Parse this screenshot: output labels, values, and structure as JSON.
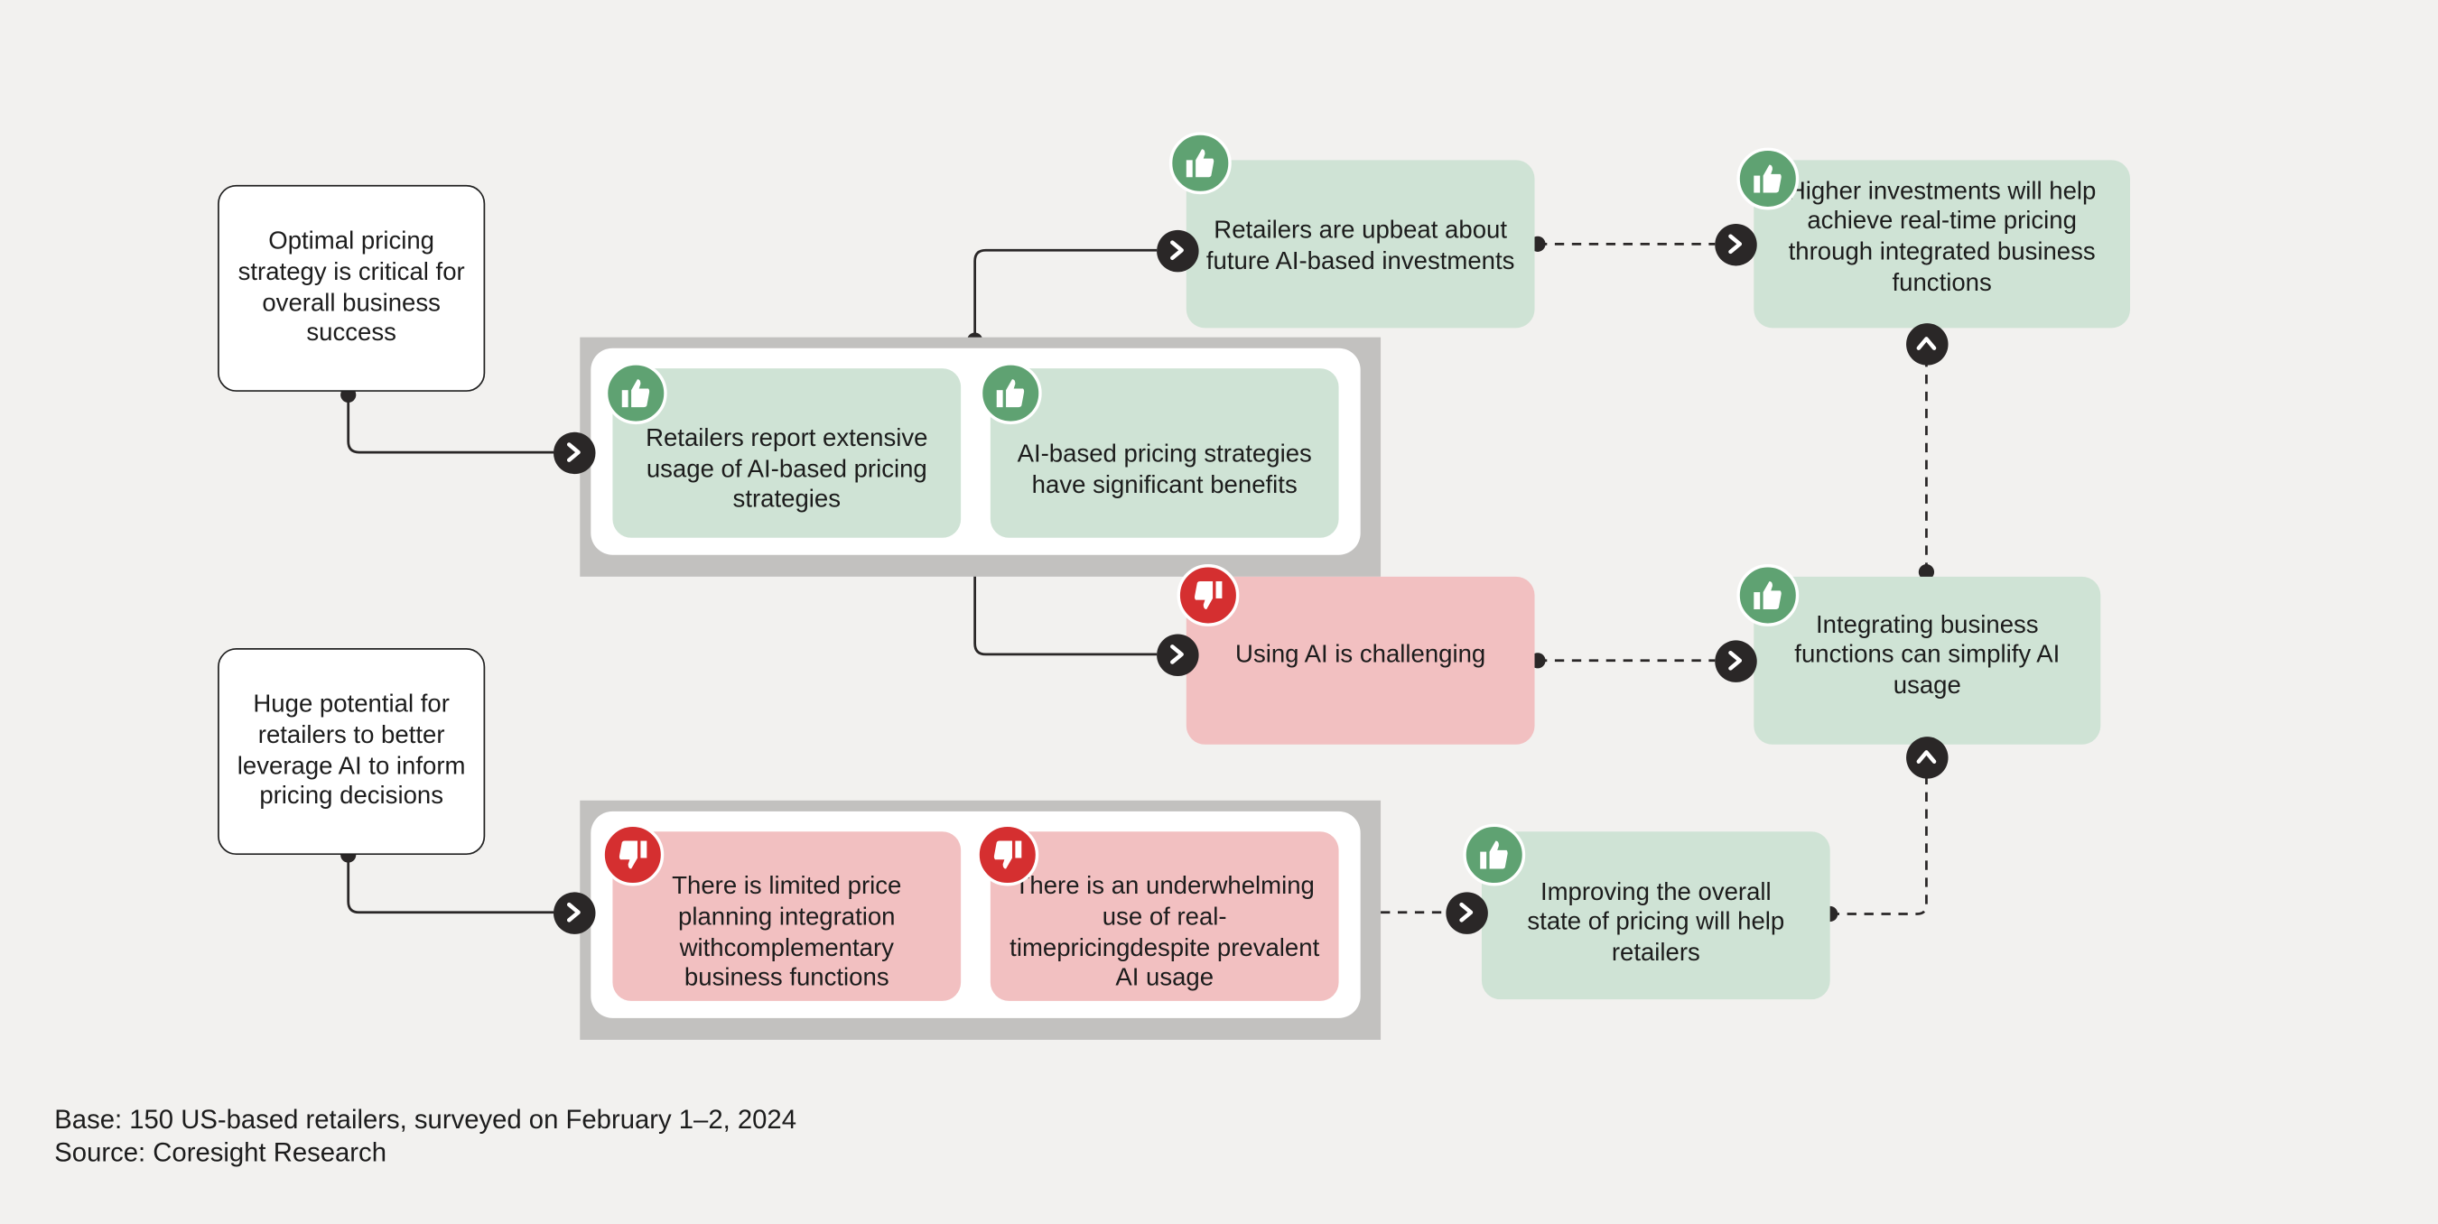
{
  "colors": {
    "background": "#f2f1ef",
    "positive_card": "#cfe3d5",
    "negative_card": "#f2c0c1",
    "positive_icon": "#5fa272",
    "negative_icon": "#d52f30",
    "frame": "#c2c1bf",
    "connector": "#2a2727"
  },
  "nodes": {
    "optimal": "Optimal pricing strategy is critical for overall business success",
    "huge": "Huge potential for retailers to better leverage AI to inform pricing decisions",
    "extensive": "Retailers report extensive usage of AI-based pricing strategies",
    "benefits": "AI-based pricing strategies have significant benefits",
    "upbeat": "Retailers are upbeat about future AI-based investments",
    "challenging": "Using AI is challenging",
    "higher": "Higher investments will help achieve real-time pricing through integrated business functions",
    "integrating": "Integrating business functions can simplify AI usage",
    "limited": "There is limited price planning integration withcomplementary business functions",
    "underwhelming": "There is an underwhelming use of real-timepricingdespite prevalent AI usage",
    "improving": "Improving the overall state of pricing will help retailers"
  },
  "icons": {
    "positive": "thumbs-up-icon",
    "negative": "thumbs-down-icon",
    "arrow": "chevron-right-icon",
    "arrow_up": "chevron-up-icon"
  },
  "footer": {
    "base": "Base: 150 US-based retailers, surveyed on February 1–2, 2024",
    "source": "Source: Coresight Research"
  }
}
